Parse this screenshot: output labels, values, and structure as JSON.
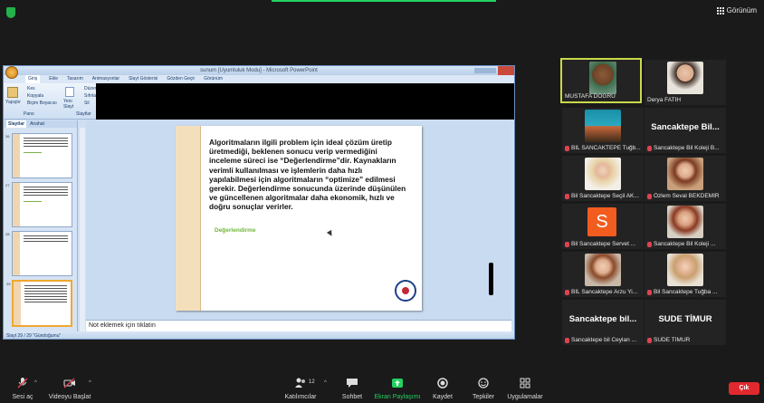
{
  "top": {
    "view_label": "Görünüm"
  },
  "ppt": {
    "window_title": "sunum [Uyumluluk Modu] - Microsoft PowerPoint",
    "ribbon_tabs": [
      "Giriş",
      "Ekle",
      "Tasarım",
      "Animasyonlar",
      "Slayt Gösterisi",
      "Gözden Geçir",
      "Görünüm"
    ],
    "ribbon": {
      "paste": "Yapıştır",
      "cut": "Kes",
      "copy": "Kopyala",
      "format_painter": "Biçim Boyacısı",
      "clipboard_group": "Pano",
      "new_slide": "Yeni Slayt",
      "layout": "Düzen",
      "reset": "Sıfırla",
      "delete": "Sil",
      "slides_group": "Slaytlar"
    },
    "left_tabs": [
      "Slaytlar",
      "Anahat"
    ],
    "thumb_numbers": [
      "26",
      "27",
      "28",
      "29"
    ],
    "slide_text": "Algoritmaların ilgili problem için ideal çözüm üretip üretmediği, beklenen sonucu verip vermediğini inceleme süreci ise “Değerlendirme”dir. Kaynakların verimli kullanılması ve işlemlerin daha hızlı yapılabilmesi için algoritmaların “optimize” edilmesi gerekir. Değerlendirme sonucunda üzerinde düşünülen ve güncellenen algoritmalar daha ekonomik, hızlı ve doğru sonuçlar verirler.",
    "slide_subtitle": "Değerlendirme",
    "notes_placeholder": "Not eklemek için tıklatın",
    "status": "Slayt 29 / 29   \"Gündoğumu\""
  },
  "participants": [
    {
      "name": "MUSTAFA DOĞRU",
      "type": "video"
    },
    {
      "name": "Derya FATİH",
      "type": "video"
    },
    {
      "name": "BİL SANCAKTEPE Tuğb...",
      "type": "video"
    },
    {
      "name": "Sancaktepe Bil Koleji B...",
      "type": "text",
      "big": "Sancaktepe  Bil..."
    },
    {
      "name": "Bil Sancaktepe Seçil AK...",
      "type": "video"
    },
    {
      "name": "Özlem Seval BEKDEMİR",
      "type": "video"
    },
    {
      "name": "Bil Sancaktepe Servet ...",
      "type": "avatar",
      "letter": "S"
    },
    {
      "name": "Sancaktepe Bil Koleji ...",
      "type": "video"
    },
    {
      "name": "BİL Sancaktepe Arzu Yi...",
      "type": "video"
    },
    {
      "name": "Bil Sancaktepe Tuğba ...",
      "type": "video"
    },
    {
      "name": "Sancaktepe bil Ceylan ...",
      "type": "text",
      "big": "Sancaktepe  bil..."
    },
    {
      "name": "SUDE TİMUR",
      "type": "text",
      "big": "SUDE TİMUR"
    }
  ],
  "toolbar": {
    "audio": "Sesi aç",
    "video": "Videoyu Başlat",
    "participants": "Katılımcılar",
    "participants_count": "12",
    "chat": "Sohbet",
    "share": "Ekran Paylaşımı",
    "record": "Kaydet",
    "reactions": "Tepkiler",
    "apps": "Uygulamalar",
    "end": "Çık"
  },
  "colors": {
    "share_green": "#23d160",
    "end_red": "#e0292e",
    "active_speaker": "#c9d94a"
  }
}
